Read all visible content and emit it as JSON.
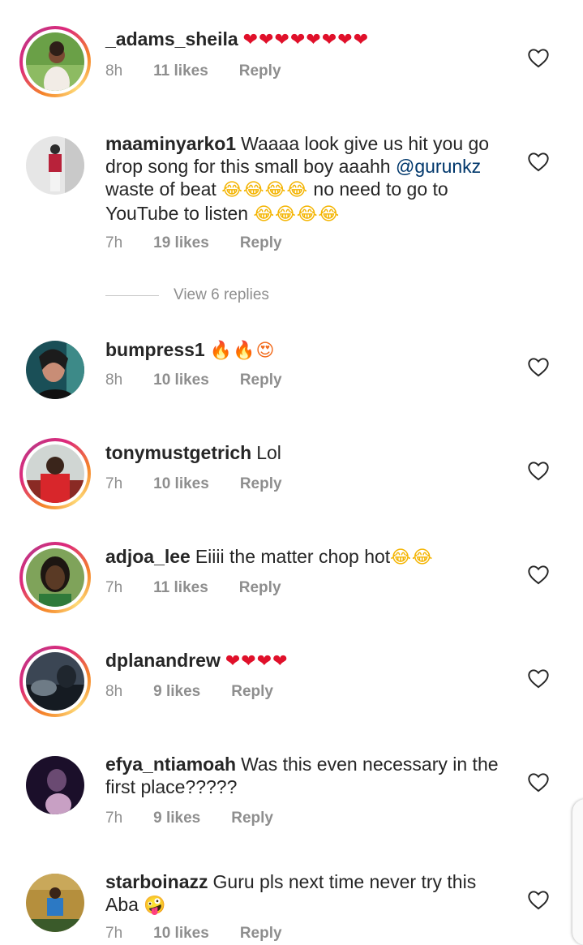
{
  "comments": [
    {
      "username": "_adams_sheila",
      "text": "",
      "emoji": "❤❤❤❤❤❤❤❤",
      "time": "8h",
      "likes": "11 likes",
      "reply": "Reply",
      "story_ring": true,
      "avatar_colors": [
        "#6aa047",
        "#e9d7c9",
        "#3a2a22"
      ]
    },
    {
      "username": "maaminyarko1",
      "text_before_mention": "Waaaa look give us hit you go drop song for this small boy aaahh",
      "mention": "@gurunkz",
      "text_after_mention": "waste of beat",
      "emoji_1": "😂😂😂😂",
      "text_after_emoji": "no need to go to YouTube to listen",
      "emoji_2": "😂😂😂😂",
      "time": "7h",
      "likes": "19 likes",
      "reply": "Reply",
      "story_ring": false,
      "avatar_colors": [
        "#e6e6e6",
        "#b8223a",
        "#2b2b2b"
      ]
    },
    {
      "username": "bumpress1",
      "emoji": "🔥🔥😍",
      "time": "8h",
      "likes": "10 likes",
      "reply": "Reply",
      "story_ring": false,
      "avatar_colors": [
        "#1a4f57",
        "#c88d76",
        "#1c1c1c"
      ]
    },
    {
      "username": "tonymustgetrich",
      "text": "Lol",
      "time": "7h",
      "likes": "10 likes",
      "reply": "Reply",
      "story_ring": true,
      "avatar_colors": [
        "#d0d6d3",
        "#d8262b",
        "#3a251b"
      ]
    },
    {
      "username": "adjoa_lee",
      "text": "Eiiii the matter chop hot",
      "emoji": "😂😂",
      "time": "7h",
      "likes": "11 likes",
      "reply": "Reply",
      "story_ring": true,
      "avatar_colors": [
        "#7fa35a",
        "#5a3a25",
        "#1d1612"
      ]
    },
    {
      "username": "dplanandrew",
      "emoji": "❤❤❤❤",
      "time": "8h",
      "likes": "9 likes",
      "reply": "Reply",
      "story_ring": true,
      "avatar_colors": [
        "#3b4654",
        "#6e7b86",
        "#151b22"
      ]
    },
    {
      "username": "efya_ntiamoah",
      "text": "Was this even necessary in the first place?????",
      "time": "7h",
      "likes": "9 likes",
      "reply": "Reply",
      "story_ring": false,
      "avatar_colors": [
        "#1b0f2a",
        "#6a4a72",
        "#c8a0c4"
      ]
    },
    {
      "username": "starboinazz",
      "text": "Guru pls next time never try this Aba",
      "emoji": "🤪",
      "time": "7h",
      "likes": "10 likes",
      "reply": "Reply",
      "story_ring": false,
      "avatar_colors": [
        "#b58f3d",
        "#2c79c4",
        "#3a5a2a"
      ]
    }
  ],
  "view_replies": "View 6 replies",
  "icons": {
    "like": "heart-outline-icon"
  }
}
